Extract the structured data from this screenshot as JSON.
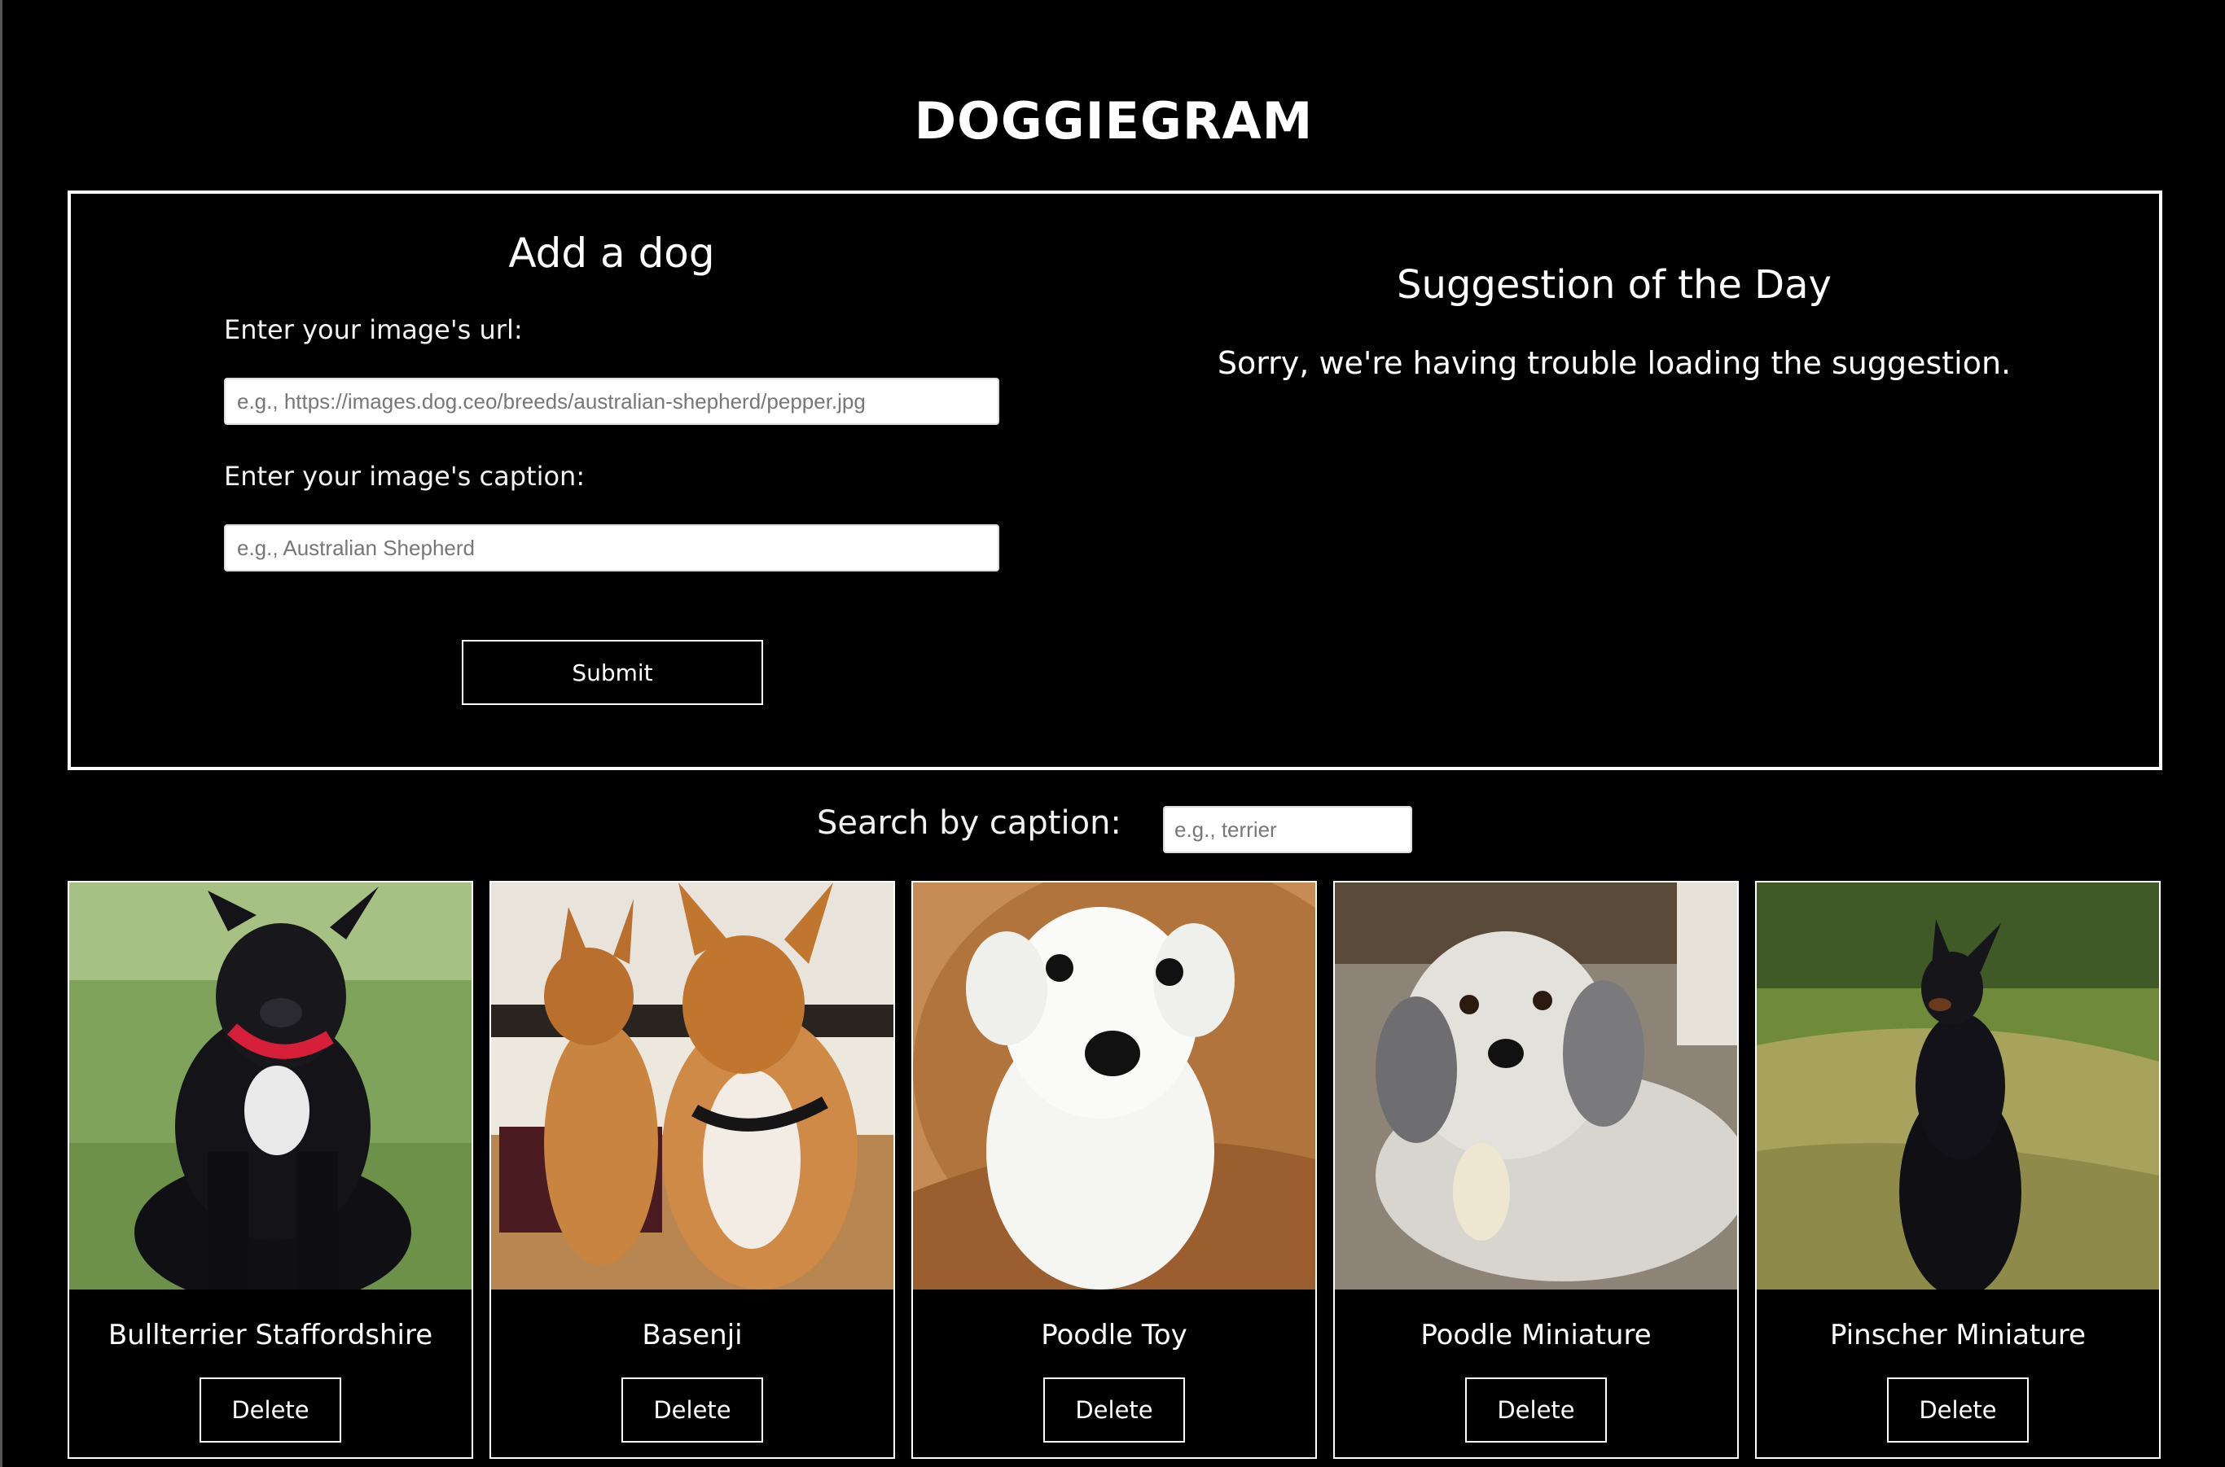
{
  "app": {
    "title": "DOGGIEGRAM"
  },
  "add_form": {
    "heading": "Add a dog",
    "url_label": "Enter your image's url:",
    "url_placeholder": "e.g., https://images.dog.ceo/breeds/australian-shepherd/pepper.jpg",
    "url_value": "",
    "caption_label": "Enter your image's caption:",
    "caption_placeholder": "e.g., Australian Shepherd",
    "caption_value": "",
    "submit_label": "Submit"
  },
  "suggestion": {
    "heading": "Suggestion of the Day",
    "message": "Sorry, we're having trouble loading the suggestion."
  },
  "search": {
    "label": "Search by caption:",
    "placeholder": "e.g., terrier",
    "value": ""
  },
  "gallery": {
    "cards": [
      {
        "caption": "Bullterrier Staffordshire",
        "delete_label": "Delete",
        "photo": "dog-photo-black-staffie"
      },
      {
        "caption": "Basenji",
        "delete_label": "Delete",
        "photo": "dog-photo-basenji-pair"
      },
      {
        "caption": "Poodle Toy",
        "delete_label": "Delete",
        "photo": "dog-photo-white-poodle"
      },
      {
        "caption": "Poodle Miniature",
        "delete_label": "Delete",
        "photo": "dog-photo-grey-poodle"
      },
      {
        "caption": "Pinscher Miniature",
        "delete_label": "Delete",
        "photo": "dog-photo-black-pinscher"
      }
    ]
  }
}
